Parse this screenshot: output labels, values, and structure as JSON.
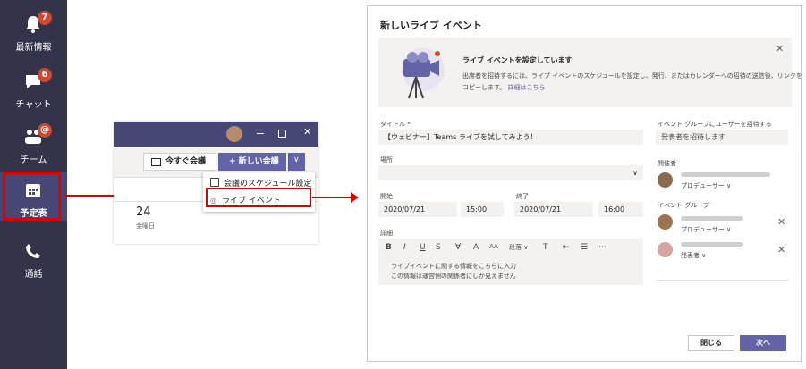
{
  "sidebar": {
    "items": [
      {
        "label": "最新情報",
        "badge": "7",
        "icon": "bell-icon"
      },
      {
        "label": "チャット",
        "badge": "6",
        "icon": "chat-icon"
      },
      {
        "label": "チーム",
        "badge": "@",
        "icon": "teams-icon"
      },
      {
        "label": "予定表",
        "icon": "calendar-icon"
      },
      {
        "label": "通話",
        "icon": "phone-icon"
      }
    ]
  },
  "mini": {
    "meet_now": "今すぐ会議",
    "new_meeting": "+ 新しい会議",
    "menu": [
      "会議のスケジュール設定",
      "ライブ イベント"
    ],
    "date_num": "24",
    "date_day": "金曜日"
  },
  "dialog": {
    "title": "新しいライブ イベント",
    "banner_title": "ライブ イベントを設定しています",
    "banner_text1": "出席者を招待するには、ライブ イベントのスケジュールを設定し、発行、またはカレンダーへの招待の送信後、リンクを",
    "banner_text2": "コピーします。",
    "banner_link": "詳細はこちら",
    "title_label": "タイトル *",
    "title_value": "【ウェビナー】Teams ライブを試してみよう！",
    "location_label": "場所",
    "start_label": "開始",
    "start_date": "2020/07/21",
    "start_time": "15:00",
    "end_label": "終了",
    "end_date": "2020/07/21",
    "end_time": "16:00",
    "detail_label": "詳細",
    "toolbar": [
      "B",
      "I",
      "U",
      "S",
      "∀",
      "A",
      "AA",
      "段落 ∨",
      "T",
      "⇤",
      "☰",
      "···"
    ],
    "detail_line1": "ライブイベントに関する情報をこちらに入力",
    "detail_line2": "この情報は運営側の関係者にしか見えません",
    "invite_label": "イベント グループにユーザーを招待する",
    "invite_placeholder": "発表者を招待します",
    "organizer_label": "開催者",
    "role_producer": "プロデューサー ∨",
    "group_label": "イベント グループ",
    "role_producer2": "プロデューサー ∨",
    "role_presenter": "発表者 ∨",
    "close_button": "閉じる",
    "next_button": "次へ"
  },
  "colors": {
    "sidebar": "#33344a",
    "accent": "#6264a7",
    "highlight": "#e00000"
  }
}
